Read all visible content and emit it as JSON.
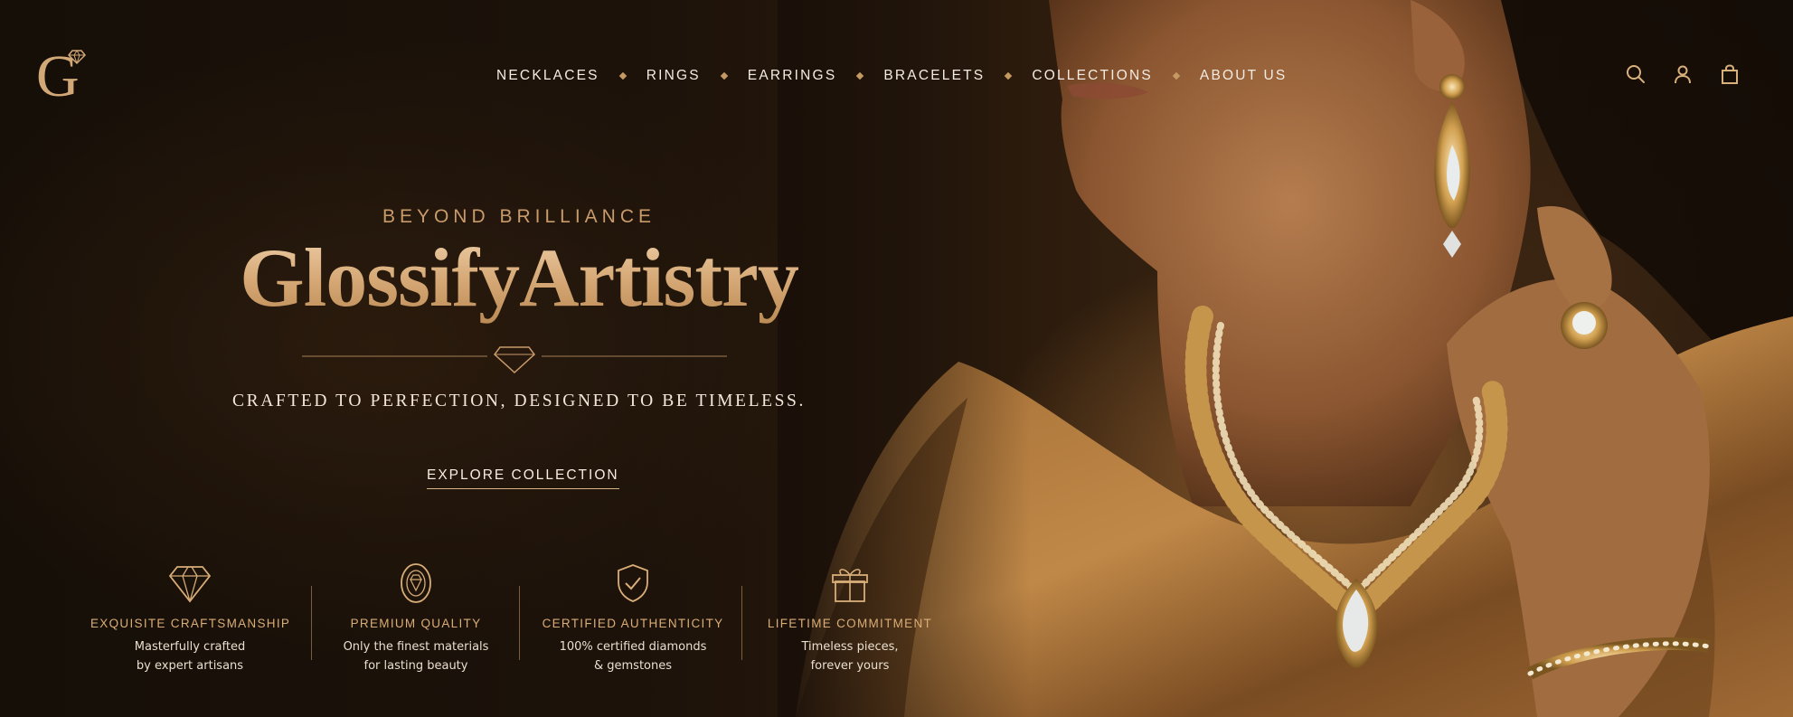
{
  "brand": {
    "logo_letter": "G",
    "eyebrow": "BEYOND BRILLIANCE",
    "name": "GlossifyArtistry",
    "tagline": "CRAFTED TO PERFECTION, DESIGNED TO BE TIMELESS.",
    "cta_label": "EXPLORE COLLECTION"
  },
  "nav": {
    "items": [
      {
        "label": "NECKLACES"
      },
      {
        "label": "RINGS"
      },
      {
        "label": "EARRINGS"
      },
      {
        "label": "BRACELETS"
      },
      {
        "label": "COLLECTIONS"
      },
      {
        "label": "ABOUT US"
      }
    ]
  },
  "header_icons": [
    "search-icon",
    "account-icon",
    "shopping-bag-icon"
  ],
  "features": [
    {
      "icon": "diamond-icon",
      "title": "EXQUISITE CRAFTSMANSHIP",
      "desc_line1": "Masterfully crafted",
      "desc_line2": "by expert artisans"
    },
    {
      "icon": "gem-medallion-icon",
      "title": "PREMIUM QUALITY",
      "desc_line1": "Only the finest materials",
      "desc_line2": "for lasting beauty"
    },
    {
      "icon": "shield-check-icon",
      "title": "CERTIFIED AUTHENTICITY",
      "desc_line1": "100% certified diamonds",
      "desc_line2": "& gemstones"
    },
    {
      "icon": "gift-icon",
      "title": "LIFETIME COMMITMENT",
      "desc_line1": "Timeless pieces,",
      "desc_line2": "forever yours"
    }
  ],
  "colors": {
    "accent_gold": "#c99a6a",
    "background": "#1a120a",
    "text_light": "#f3e6d2"
  }
}
